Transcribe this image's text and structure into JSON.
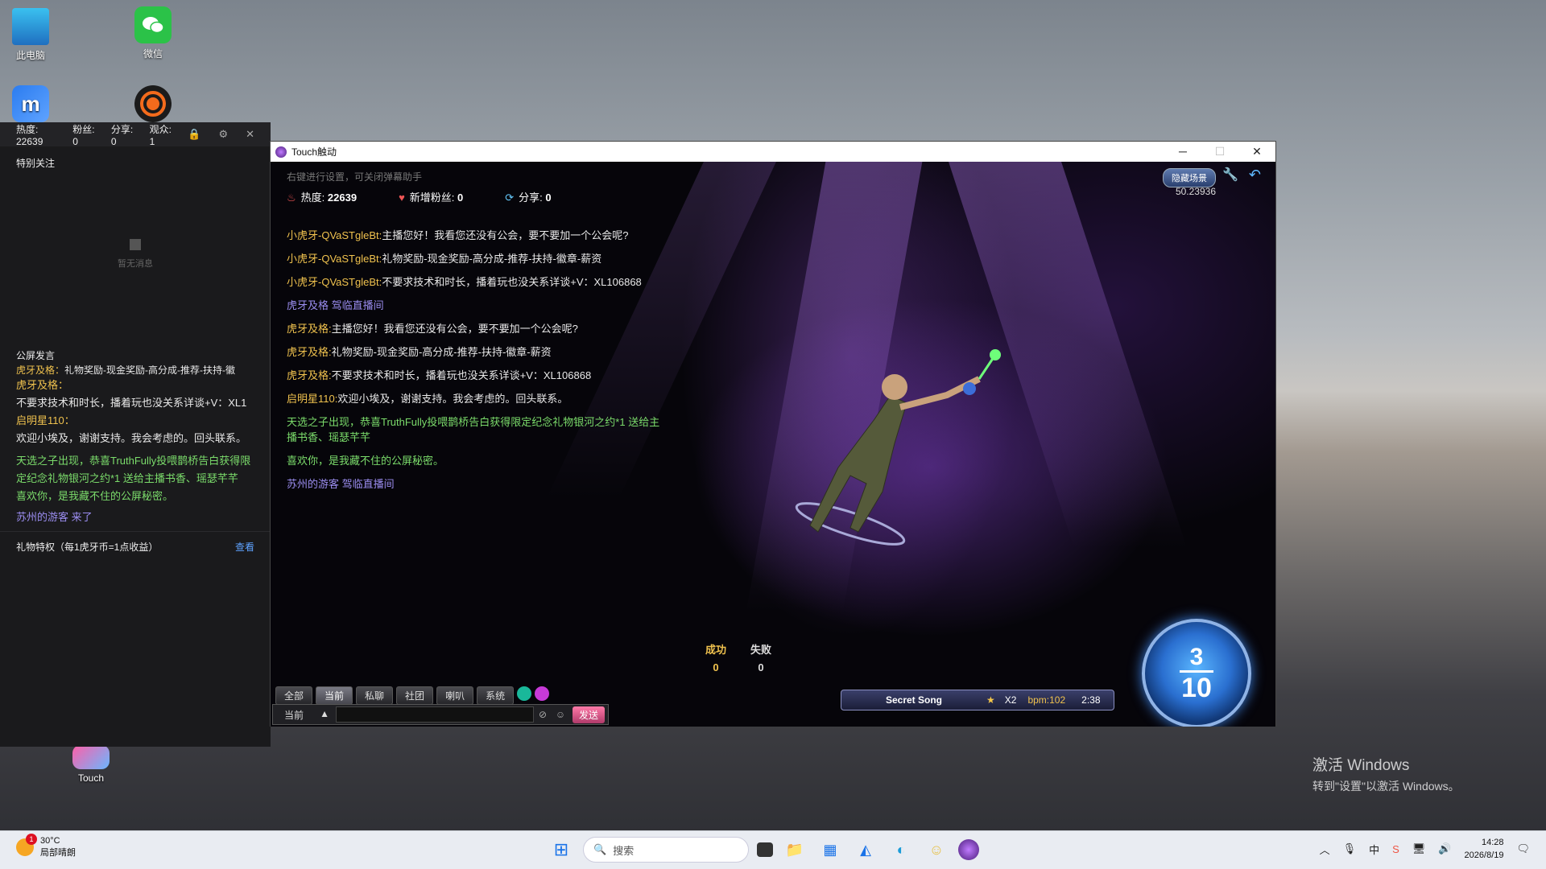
{
  "desktop": {
    "icons": [
      {
        "label": "此电脑"
      },
      {
        "label": "微信"
      },
      {
        "label": "Touch"
      }
    ]
  },
  "helper_panel": {
    "stats": [
      {
        "label": "热度:",
        "value": "22639"
      },
      {
        "label": "粉丝:",
        "value": "0"
      },
      {
        "label": "分享:",
        "value": "0"
      },
      {
        "label": "观众:",
        "value": "1"
      }
    ],
    "special_follow_title": "特别关注",
    "empty_text": "暂无消息",
    "public_chat_title": "公屏发言",
    "chat": [
      {
        "name": "虎牙及格：",
        "text": "礼物奖励-现金奖励-高分成-推荐-扶持-徽"
      },
      {
        "name": "虎牙及格：",
        "text": "不要求技术和时长，播着玩也没关系详谈+V：XL1"
      },
      {
        "name": "启明星110：",
        "text": "欢迎小埃及，谢谢支持。我会考虑的。回头联系。"
      }
    ],
    "system_msgs": [
      "天选之子出现，恭喜TruthFully投喂鹊桥告白获得限定纪念礼物银河之约*1 送给主播书香、瑶瑟芊芊",
      "喜欢你，是我藏不住的公屏秘密。"
    ],
    "enter_msg": "苏州的游客 来了",
    "gift_title": "礼物特权（每1虎牙币=1点收益）",
    "gift_link": "查看"
  },
  "game_window": {
    "title": "Touch触动",
    "hint": "右键进行设置，可关闭弹幕助手",
    "stats": {
      "heat_label": "热度:",
      "heat": "22639",
      "fans_label": "新增粉丝:",
      "fans": "0",
      "share_label": "分享:",
      "share": "0"
    },
    "hide_scene": "隐藏场景",
    "fps": "50.23936",
    "chat": [
      {
        "name": "小虎牙-QVaSTgleBt:",
        "text": "主播您好！我看您还没有公会，要不要加一个公会呢?",
        "type": "msg"
      },
      {
        "name": "小虎牙-QVaSTgleBt:",
        "text": "礼物奖励-现金奖励-高分成-推荐-扶持-徽章-薪资",
        "type": "msg"
      },
      {
        "name": "小虎牙-QVaSTgleBt:",
        "text": "不要求技术和时长，播着玩也没关系详谈+V：XL106868",
        "type": "msg"
      },
      {
        "name": "",
        "text": "虎牙及格 驾临直播间",
        "type": "enter"
      },
      {
        "name": "虎牙及格:",
        "text": "主播您好！我看您还没有公会，要不要加一个公会呢?",
        "type": "msg"
      },
      {
        "name": "虎牙及格:",
        "text": "礼物奖励-现金奖励-高分成-推荐-扶持-徽章-薪资",
        "type": "msg"
      },
      {
        "name": "虎牙及格:",
        "text": "不要求技术和时长，播着玩也没关系详谈+V：XL106868",
        "type": "msg"
      },
      {
        "name": "启明星110:",
        "text": "欢迎小埃及，谢谢支持。我会考虑的。回头联系。",
        "type": "msg"
      },
      {
        "name": "",
        "text": "天选之子出现，恭喜TruthFully投喂鹊桥告白获得限定纪念礼物银河之约*1 送给主播书香、瑶瑟芊芊",
        "type": "system"
      },
      {
        "name": "",
        "text": "喜欢你，是我藏不住的公屏秘密。",
        "type": "system"
      },
      {
        "name": "",
        "text": "苏州的游客 驾临直播间",
        "type": "enter"
      }
    ],
    "score": {
      "success_label": "成功",
      "success": "0",
      "fail_label": "失败",
      "fail": "0"
    },
    "song": {
      "name": "Secret Song",
      "multiplier": "X2",
      "bpm": "bpm:102",
      "time": "2:38"
    },
    "round": {
      "current": "3",
      "total": "10"
    },
    "chat_tabs": [
      "全部",
      "当前",
      "私聊",
      "社团",
      "喇叭",
      "系统"
    ],
    "active_tab": 1,
    "channel": "当前",
    "input_value": "",
    "send_label": "发送"
  },
  "watermark": {
    "line1": "激活 Windows",
    "line2": "转到\"设置\"以激活 Windows。"
  },
  "taskbar": {
    "weather_temp": "30°C",
    "weather_desc": "局部晴朗",
    "weather_badge": "1",
    "search_placeholder": "搜索",
    "time": "14:28",
    "date": "2026/8/19"
  }
}
